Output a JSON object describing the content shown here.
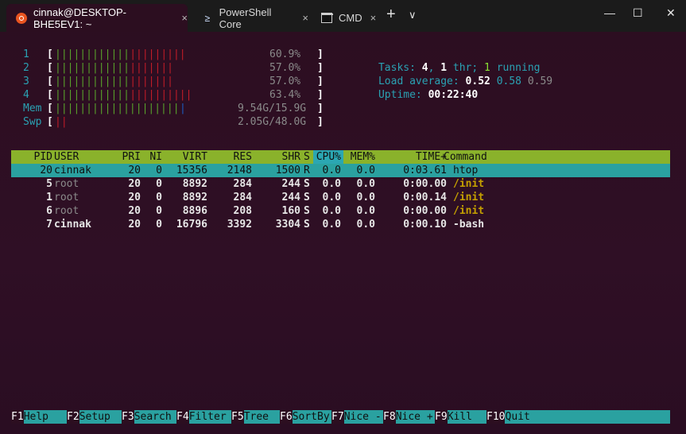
{
  "tabs": [
    {
      "label": "cinnak@DESKTOP-BHE5EV1: ~",
      "close": "×",
      "icon": "ubuntu-icon"
    },
    {
      "label": "PowerShell Core",
      "close": "×",
      "icon": "powershell-icon",
      "glyph": "≥"
    },
    {
      "label": "CMD",
      "close": "×",
      "icon": "cmd-icon"
    }
  ],
  "titlebar": {
    "new_tab": "+",
    "dropdown": "∨",
    "minimize": "—",
    "maximize": "☐",
    "close": "✕"
  },
  "cpus": [
    {
      "num": "1",
      "value": "60.9%",
      "green": 12,
      "red": 9
    },
    {
      "num": "2",
      "value": "57.0%",
      "green": 12,
      "red": 7
    },
    {
      "num": "3",
      "value": "57.0%",
      "green": 12,
      "red": 7
    },
    {
      "num": "4",
      "value": "63.4%",
      "green": 12,
      "red": 10
    }
  ],
  "mem": {
    "label": "Mem",
    "value": "9.54G/15.9G",
    "green": 20,
    "blue": 1
  },
  "swp": {
    "label": "Swp",
    "value": "2.05G/48.0G",
    "red": 2
  },
  "summary": {
    "tasks_label": "Tasks:",
    "tasks": "4",
    "thr": "1",
    "thr_label": "thr;",
    "running": "1",
    "running_label": "running",
    "load_label": "Load average:",
    "load1": "0.52",
    "load5": "0.58",
    "load15": "0.59",
    "uptime_label": "Uptime:",
    "uptime": "00:22:40"
  },
  "columns": [
    "PID",
    "USER",
    "PRI",
    "NI",
    "VIRT",
    "RES",
    "SHR",
    "S",
    "CPU%",
    "MEM%",
    "TIME+",
    "Command"
  ],
  "processes": [
    {
      "pid": "20",
      "user": "cinnak",
      "pri": "20",
      "ni": "0",
      "virt": "15356",
      "res": "2148",
      "shr": "1500",
      "s": "R",
      "cpu": "0.0",
      "mem": "0.0",
      "time": "0:03.61",
      "cmd": "htop"
    },
    {
      "pid": "5",
      "user": "root",
      "pri": "20",
      "ni": "0",
      "virt": "8892",
      "res": "284",
      "shr": "244",
      "s": "S",
      "cpu": "0.0",
      "mem": "0.0",
      "time": "0:00.00",
      "cmd": "/init"
    },
    {
      "pid": "1",
      "user": "root",
      "pri": "20",
      "ni": "0",
      "virt": "8892",
      "res": "284",
      "shr": "244",
      "s": "S",
      "cpu": "0.0",
      "mem": "0.0",
      "time": "0:00.14",
      "cmd": "/init"
    },
    {
      "pid": "6",
      "user": "root",
      "pri": "20",
      "ni": "0",
      "virt": "8896",
      "res": "208",
      "shr": "160",
      "s": "S",
      "cpu": "0.0",
      "mem": "0.0",
      "time": "0:00.00",
      "cmd": "/init"
    },
    {
      "pid": "7",
      "user": "cinnak",
      "pri": "20",
      "ni": "0",
      "virt": "16796",
      "res": "3392",
      "shr": "3304",
      "s": "S",
      "cpu": "0.0",
      "mem": "0.0",
      "time": "0:00.10",
      "cmd": "-bash"
    }
  ],
  "footer": [
    {
      "key": "F1",
      "label": "Help"
    },
    {
      "key": "F2",
      "label": "Setup"
    },
    {
      "key": "F3",
      "label": "Search"
    },
    {
      "key": "F4",
      "label": "Filter"
    },
    {
      "key": "F5",
      "label": "Tree"
    },
    {
      "key": "F6",
      "label": "SortBy"
    },
    {
      "key": "F7",
      "label": "Nice -"
    },
    {
      "key": "F8",
      "label": "Nice +"
    },
    {
      "key": "F9",
      "label": "Kill"
    },
    {
      "key": "F10",
      "label": "Quit"
    }
  ],
  "colors": {
    "accent_green": "#8ab22b",
    "accent_cyan": "#2aa1a0",
    "background": "#2c0e20",
    "titlebar": "#1b1b1b"
  }
}
